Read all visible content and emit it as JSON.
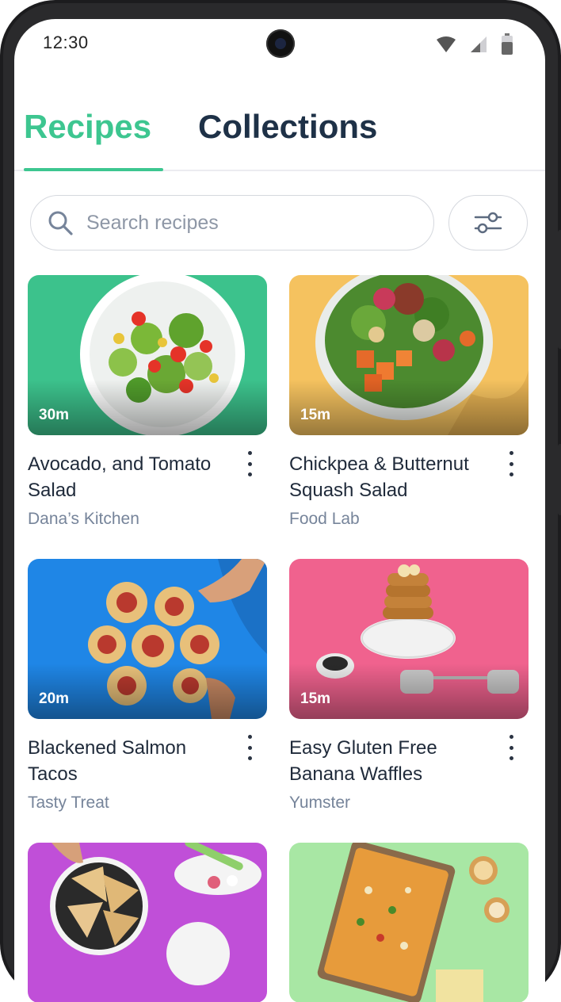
{
  "status_bar": {
    "time": "12:30"
  },
  "tabs": [
    {
      "label": "Recipes",
      "active": true
    },
    {
      "label": "Collections",
      "active": false
    }
  ],
  "search": {
    "placeholder": "Search recipes"
  },
  "recipes": [
    {
      "title": "Avocado, and Tomato Salad",
      "source": "Dana’s Kitchen",
      "time": "30m",
      "bg": "#3cc28c"
    },
    {
      "title": "Chickpea & Butternut Squash Salad",
      "source": "Food Lab",
      "time": "15m",
      "bg": "#f5c25f"
    },
    {
      "title": "Blackened Salmon Tacos",
      "source": "Tasty Treat",
      "time": "20m",
      "bg": "#1f86e6"
    },
    {
      "title": "Easy Gluten Free Banana Waffles",
      "source": "Yumster",
      "time": "15m",
      "bg": "#f0628e"
    },
    {
      "title": "",
      "source": "",
      "time": "",
      "bg": "#c04fd8"
    },
    {
      "title": "",
      "source": "",
      "time": "",
      "bg": "#a8e7a4"
    }
  ],
  "colors": {
    "accent": "#3dc690",
    "heading": "#1e3147",
    "muted": "#76849a"
  }
}
